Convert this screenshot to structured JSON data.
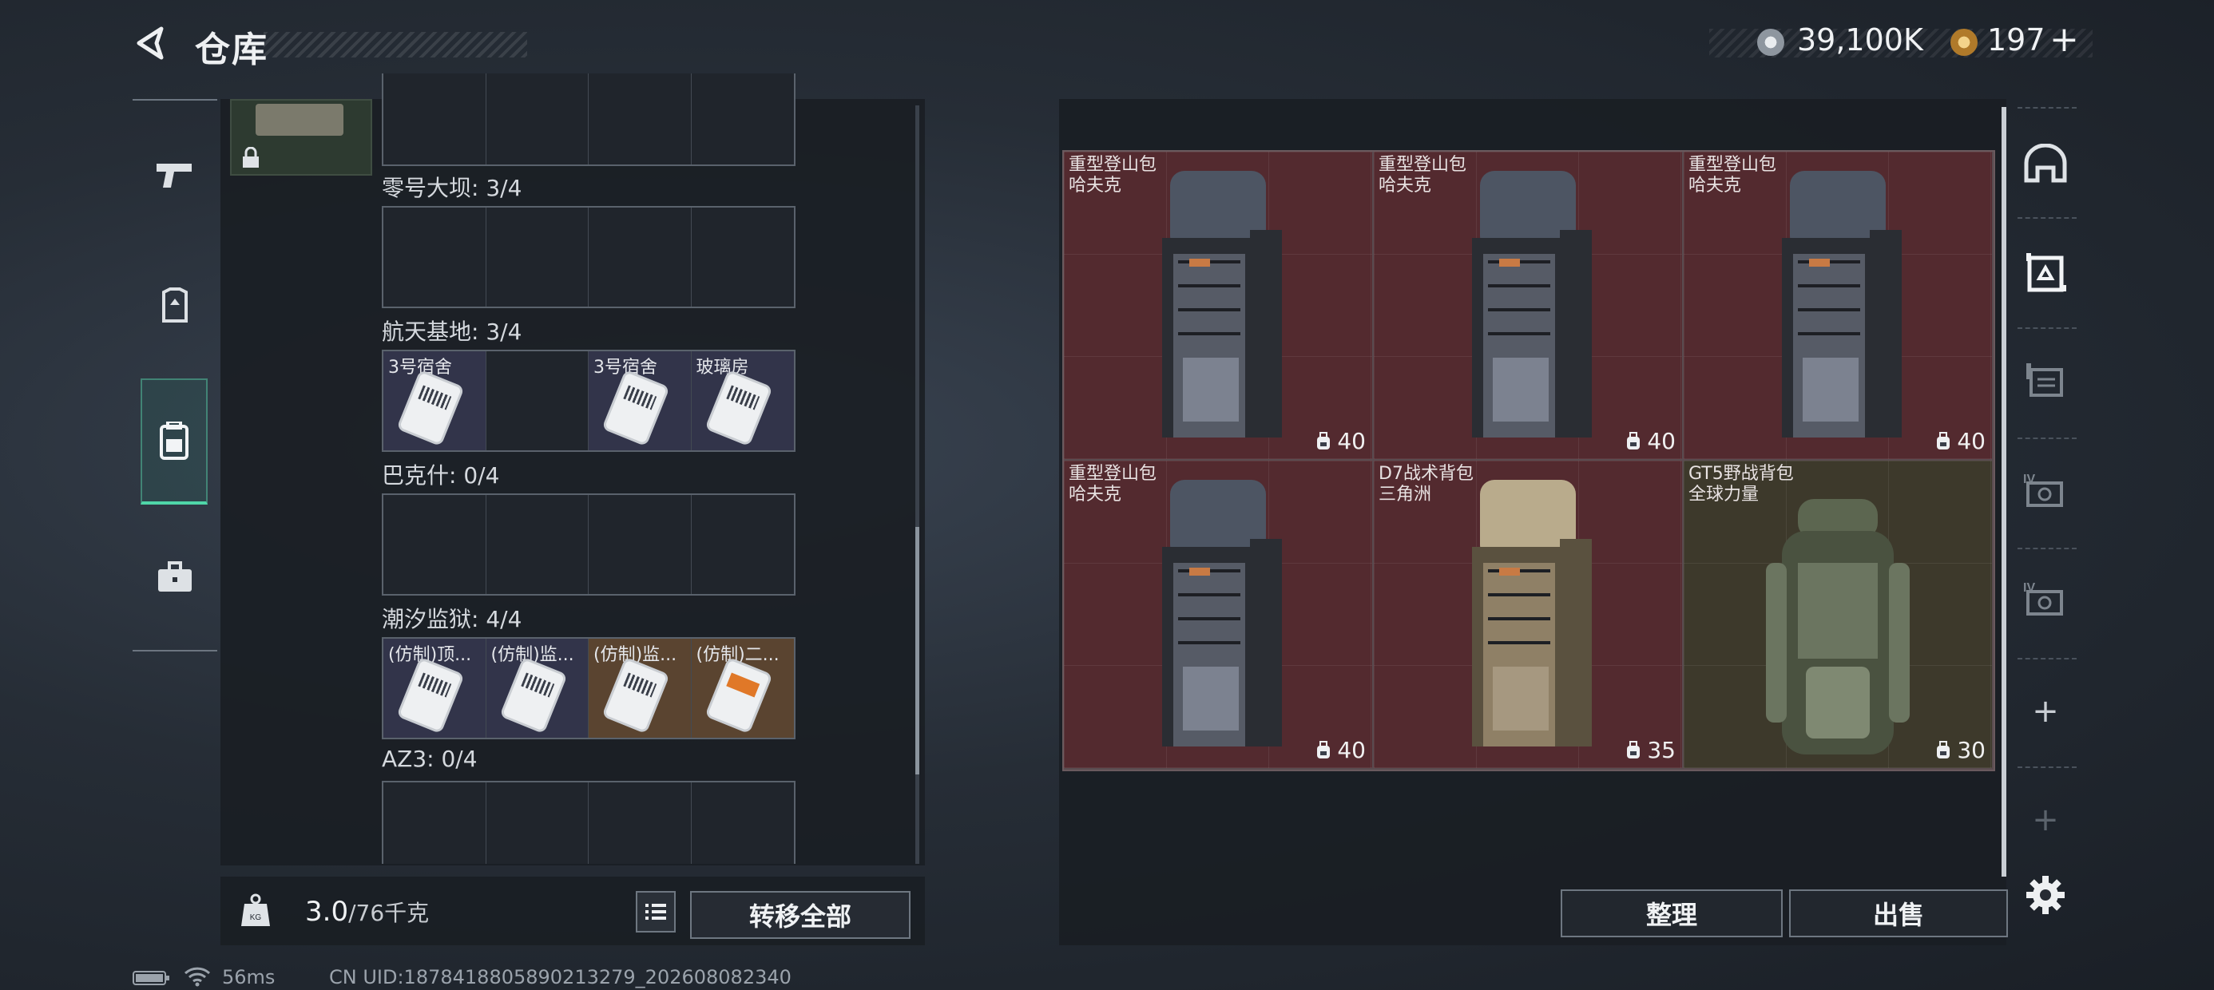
{
  "header": {
    "title": "仓库",
    "currency": {
      "coins": "39,100K",
      "tokens": "197",
      "add": "+"
    }
  },
  "left_nav": [
    "weapons-tab",
    "armor-tab",
    "backpack-tab",
    "equipment-tab"
  ],
  "storage": {
    "sections": [
      {
        "label": "零号大坝: 3/4",
        "cells": [
          null,
          null,
          null,
          null
        ]
      },
      {
        "label": "航天基地: 3/4",
        "cells": [
          {
            "name": "3号宿舍",
            "tone": "key"
          },
          null,
          {
            "name": "3号宿舍",
            "tone": "key"
          },
          {
            "name": "玻璃房",
            "tone": "key"
          }
        ]
      },
      {
        "label": "巴克什: 0/4",
        "cells": [
          null,
          null,
          null,
          null
        ]
      },
      {
        "label": "潮汐监狱: 4/4",
        "cells": [
          {
            "name": "(仿制)顶...",
            "tone": "key"
          },
          {
            "name": "(仿制)监...",
            "tone": "key"
          },
          {
            "name": "(仿制)监...",
            "tone": "key2"
          },
          {
            "name": "(仿制)二...",
            "tone": "key2"
          }
        ]
      },
      {
        "label": "AZ3: 0/4",
        "cells": [
          null,
          null,
          null,
          null
        ]
      }
    ],
    "weight": {
      "current": "3.0",
      "capacity": "/76千克"
    },
    "transfer_all": "转移全部"
  },
  "backpacks": [
    {
      "name": "重型登山包",
      "brand": "哈夫克",
      "capacity": "40",
      "style": "grey",
      "bg": "red"
    },
    {
      "name": "重型登山包",
      "brand": "哈夫克",
      "capacity": "40",
      "style": "grey",
      "bg": "red"
    },
    {
      "name": "重型登山包",
      "brand": "哈夫克",
      "capacity": "40",
      "style": "grey",
      "bg": "red"
    },
    {
      "name": "重型登山包",
      "brand": "哈夫克",
      "capacity": "40",
      "style": "grey",
      "bg": "red"
    },
    {
      "name": "D7战术背包",
      "brand": "三角洲",
      "capacity": "35",
      "style": "tan",
      "bg": "red"
    },
    {
      "name": "GT5野战背包",
      "brand": "全球力量",
      "capacity": "30",
      "style": "green",
      "bg": "olive"
    }
  ],
  "actions": {
    "arrange": "整理",
    "sell": "出售"
  },
  "right_nav": {
    "plus1": "+",
    "plus2": "+"
  },
  "status_bar": {
    "ping": "56ms",
    "uid": "CN UID:18784188058902132​79_202608082340"
  }
}
